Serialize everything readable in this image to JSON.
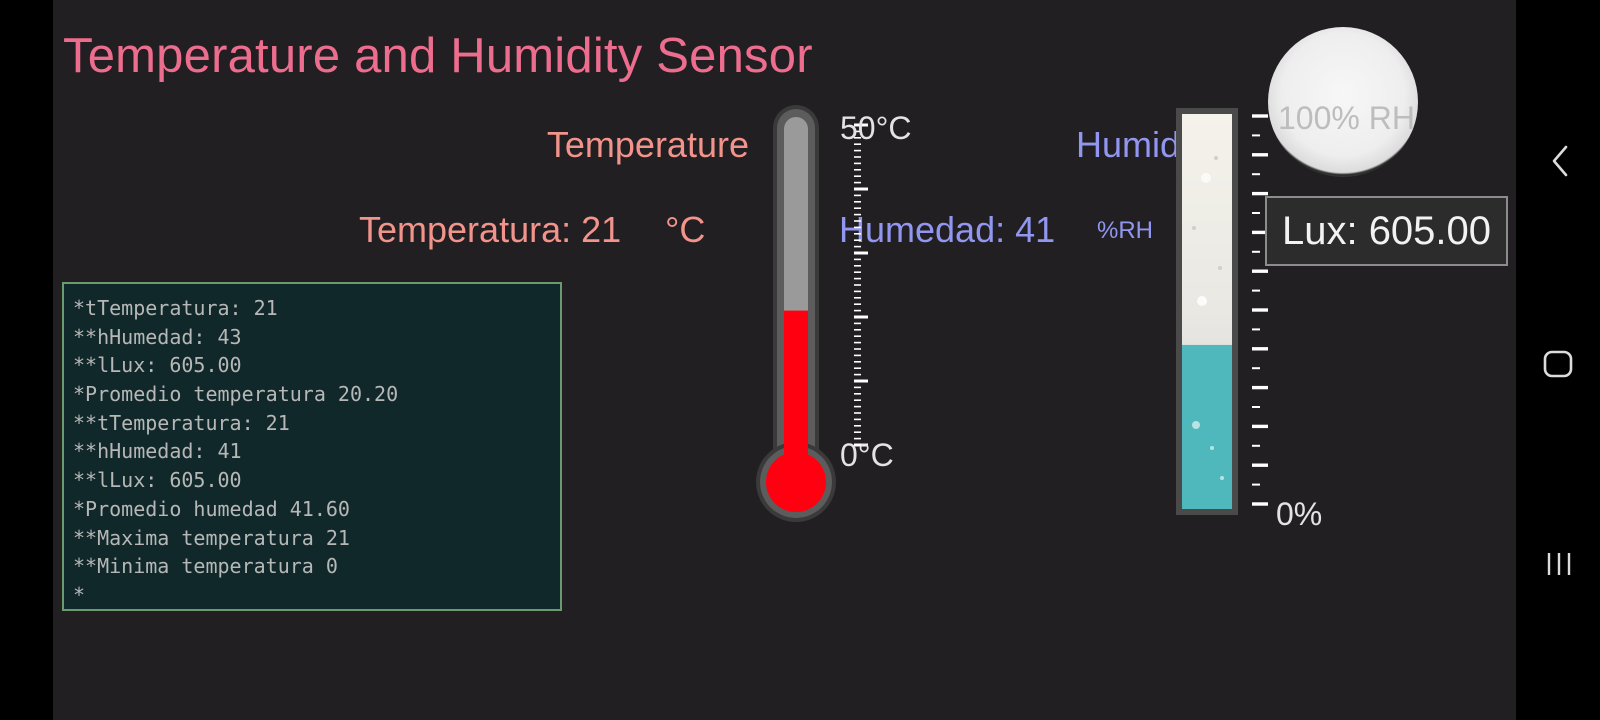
{
  "app": {
    "title": "Temperature and Humidity Sensor"
  },
  "temperature": {
    "label": "Temperature",
    "value_text": "Temperatura: 21",
    "unit": "°C",
    "gauge": {
      "max_label": "50°C",
      "min_label": "0°C",
      "min": 0,
      "max": 50,
      "value": 21,
      "fill_color": "#ff0010"
    }
  },
  "humidity": {
    "label": "Humidity",
    "value_text": "Humedad: 41",
    "unit": "%RH",
    "gauge": {
      "max_label": "100% RH",
      "min_label": "0%",
      "min": 0,
      "max": 100,
      "value": 41,
      "fill_color": "#4fb8bc"
    }
  },
  "lux": {
    "text": "Lux: 605.00"
  },
  "terminal": {
    "lines": [
      "*tTemperatura: 21",
      "**hHumedad: 43",
      "**lLux: 605.00",
      "*Promedio temperatura 20.20",
      "**tTemperatura: 21",
      "**hHumedad: 41",
      "**lLux: 605.00",
      "*Promedio humedad 41.60",
      "**Maxima temperatura 21",
      "**Minima temperatura 0",
      "*"
    ]
  },
  "navigation_bar": {
    "icons": [
      "back-icon",
      "home-icon",
      "recent-apps-icon"
    ]
  },
  "colors": {
    "background": "#221f22",
    "title": "#ed6d8e",
    "temperature_text": "#f2948b",
    "humidity_text": "#9197f0",
    "terminal_bg": "#10282a",
    "terminal_border": "#6b9a6f"
  }
}
